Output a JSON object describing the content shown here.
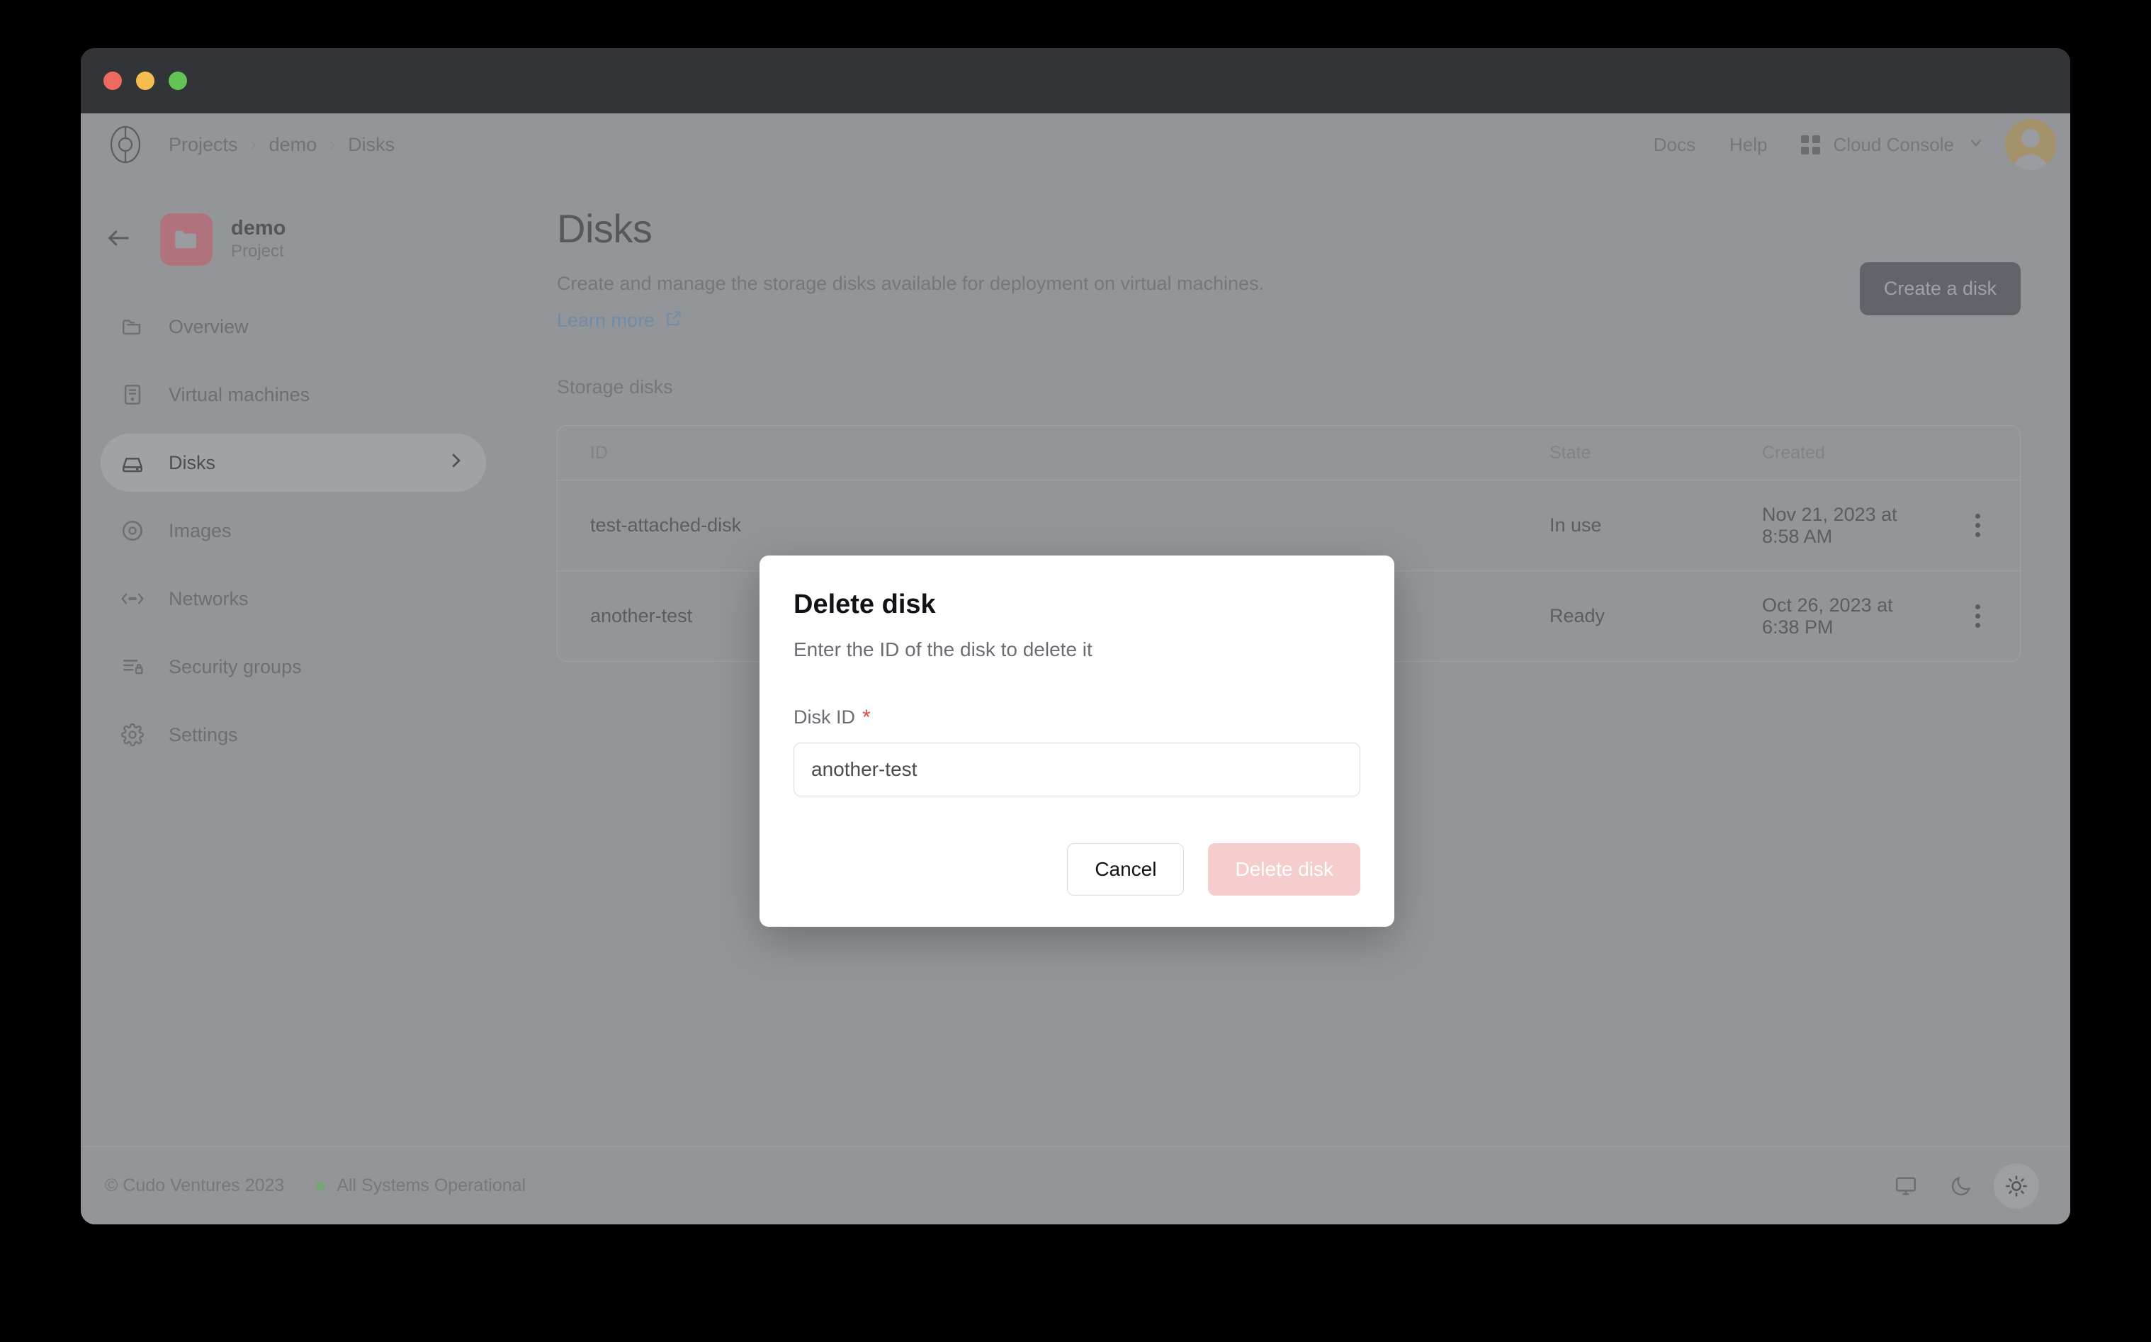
{
  "window": {
    "traffic_lights": [
      "close",
      "minimize",
      "zoom"
    ]
  },
  "topbar": {
    "logo_icon": "cudo-logo-icon",
    "breadcrumb": [
      "Projects",
      "demo",
      "Disks"
    ],
    "separator": "›",
    "links": [
      "Docs",
      "Help"
    ],
    "console_switcher": {
      "label": "Cloud Console",
      "grid_icon": "grid-icon",
      "chevron_icon": "chevron-down-icon"
    },
    "avatar_icon": "user-avatar-icon"
  },
  "sidebar": {
    "back_icon": "arrow-left-icon",
    "project": {
      "name": "demo",
      "subtitle": "Project",
      "icon": "folder-icon",
      "icon_color": "#b0737e"
    },
    "items": [
      {
        "label": "Overview",
        "icon": "folder-open-icon",
        "active": false,
        "chevron": ""
      },
      {
        "label": "Virtual machines",
        "icon": "server-icon",
        "active": false,
        "chevron": ""
      },
      {
        "label": "Disks",
        "icon": "hard-drive-icon",
        "active": true,
        "chevron": "›"
      },
      {
        "label": "Images",
        "icon": "disc-icon",
        "active": false,
        "chevron": ""
      },
      {
        "label": "Networks",
        "icon": "network-icon",
        "active": false,
        "chevron": ""
      },
      {
        "label": "Security groups",
        "icon": "shield-lock-icon",
        "active": false,
        "chevron": ""
      },
      {
        "label": "Settings",
        "icon": "gear-icon",
        "active": false,
        "chevron": ""
      }
    ]
  },
  "main": {
    "title": "Disks",
    "description": "Create and manage the storage disks available for deployment on virtual machines.",
    "learn_more": "Learn more",
    "learn_more_icon": "external-link-icon",
    "create_button": "Create a disk",
    "section_label": "Storage disks"
  },
  "table": {
    "columns": [
      "ID",
      "",
      "",
      "",
      "State",
      "Created",
      ""
    ],
    "rows": [
      {
        "id": "test-attached-disk",
        "size": "",
        "type": "",
        "vm": "",
        "state": "In use",
        "created": "Nov 21, 2023 at 8:58 AM",
        "menu_icon": "kebab-menu-icon"
      },
      {
        "id": "another-test",
        "size": "",
        "type": "",
        "vm": "",
        "state": "Ready",
        "created": "Oct 26, 2023 at 6:38 PM",
        "menu_icon": "kebab-menu-icon"
      }
    ]
  },
  "footer": {
    "copyright": "© Cudo Ventures 2023",
    "status_text": "All Systems Operational",
    "status_color": "#77a377",
    "themes": [
      {
        "name": "system-theme-button",
        "icon": "monitor-icon",
        "active": false
      },
      {
        "name": "dark-theme-button",
        "icon": "moon-icon",
        "active": false
      },
      {
        "name": "light-theme-button",
        "icon": "sun-icon",
        "active": true
      }
    ]
  },
  "modal": {
    "title": "Delete disk",
    "subtitle": "Enter the ID of the disk to delete it",
    "field_label": "Disk ID",
    "required_marker": "*",
    "input_value": "another-test",
    "input_placeholder": "Disk ID",
    "cancel_label": "Cancel",
    "confirm_label": "Delete disk",
    "confirm_color": "#f5cdcd",
    "required_color": "#dd4b4b"
  }
}
